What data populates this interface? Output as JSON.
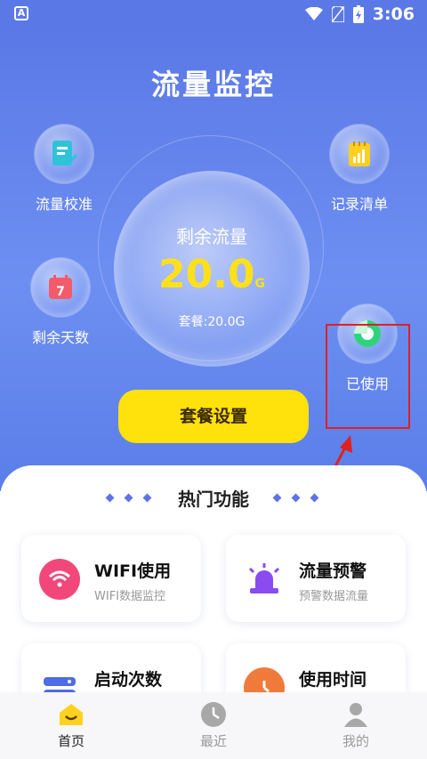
{
  "status_bar": {
    "time": "3:06",
    "left_icon": "A"
  },
  "header": {
    "title": "流量监控"
  },
  "side_buttons": {
    "calibrate": {
      "label": "流量校准",
      "icon": "document-check-icon"
    },
    "days_left": {
      "label": "剩余天数",
      "icon": "calendar-icon",
      "icon_text": "7"
    },
    "records": {
      "label": "记录清单",
      "icon": "bar-chart-notebook-icon"
    },
    "used": {
      "label": "已使用",
      "icon": "pie-chart-icon"
    }
  },
  "center": {
    "label": "剩余流量",
    "value": "20.0",
    "unit": "G",
    "plan": "套餐:20.0G"
  },
  "plan_button": {
    "label": "套餐设置"
  },
  "hot": {
    "title": "热门功能",
    "cards": [
      {
        "title": "WIFI使用",
        "subtitle": "WIFI数据监控",
        "icon": "wifi-icon",
        "color": "#f2477a"
      },
      {
        "title": "流量预警",
        "subtitle": "预警数据流量",
        "icon": "alarm-light-icon",
        "color": "#8a4bf0"
      },
      {
        "title": "启动次数",
        "subtitle": "",
        "icon": "server-icon",
        "color": "#4f6be6"
      },
      {
        "title": "使用时间",
        "subtitle": "",
        "icon": "clock-icon",
        "color": "#f07a3a"
      }
    ]
  },
  "tabs": [
    {
      "label": "首页",
      "icon": "home-icon",
      "active": true
    },
    {
      "label": "最近",
      "icon": "clock-icon",
      "active": false
    },
    {
      "label": "我的",
      "icon": "user-icon",
      "active": false
    }
  ],
  "colors": {
    "primary": "#5b79e6",
    "accent": "#ffe10c",
    "highlight": "#e02020"
  }
}
